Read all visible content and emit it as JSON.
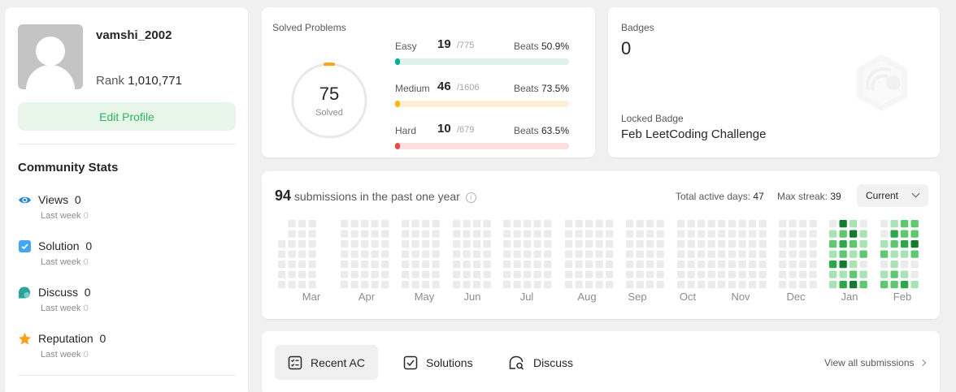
{
  "profile": {
    "username": "vamshi_2002",
    "rank_label": "Rank",
    "rank_value": "1,010,771",
    "edit_button": "Edit Profile"
  },
  "community": {
    "title": "Community Stats",
    "stats": [
      {
        "label": "Views",
        "value": "0",
        "sub_label": "Last week",
        "sub_value": "0",
        "icon": "eye-icon",
        "color": "#1e88e5"
      },
      {
        "label": "Solution",
        "value": "0",
        "sub_label": "Last week",
        "sub_value": "0",
        "icon": "solution-check-icon",
        "color": "#42a5f5"
      },
      {
        "label": "Discuss",
        "value": "0",
        "sub_label": "Last week",
        "sub_value": "0",
        "icon": "discuss-bubble-icon",
        "color": "#26a69a"
      },
      {
        "label": "Reputation",
        "value": "0",
        "sub_label": "Last week",
        "sub_value": "0",
        "icon": "star-icon",
        "color": "#ffa116"
      }
    ]
  },
  "solved": {
    "label": "Solved Problems",
    "total": "75",
    "total_label": "Solved",
    "difficulties": [
      {
        "name": "Easy",
        "count": "19",
        "total": "/775",
        "beats_label": "Beats",
        "beats": "50.9%",
        "fraction": 0.0245,
        "color": "#00af9b",
        "track": "#dcf1e8"
      },
      {
        "name": "Medium",
        "count": "46",
        "total": "/1606",
        "beats_label": "Beats",
        "beats": "73.5%",
        "fraction": 0.0286,
        "color": "#ffb800",
        "track": "#fdf0d6"
      },
      {
        "name": "Hard",
        "count": "10",
        "total": "/679",
        "beats_label": "Beats",
        "beats": "63.5%",
        "fraction": 0.0147,
        "color": "#ef4743",
        "track": "#fbe0df"
      }
    ]
  },
  "badges": {
    "label": "Badges",
    "count": "0",
    "locked_label": "Locked Badge",
    "locked_name": "Feb LeetCoding Challenge"
  },
  "submissions": {
    "count": "94",
    "text": "submissions in the past one year",
    "active_days_label": "Total active days:",
    "active_days": "47",
    "max_streak_label": "Max streak:",
    "max_streak": "39",
    "select_value": "Current",
    "months": [
      "Mar",
      "Apr",
      "May",
      "Jun",
      "Jul",
      "Aug",
      "Sep",
      "Oct",
      "Nov",
      "Dec",
      "Jan",
      "Feb"
    ],
    "colors": {
      "empty": "#ebebeb",
      "l1": "#a8e3b4",
      "l2": "#5cc96f",
      "l3": "#2aa84a",
      "l4": "#137b2e"
    }
  },
  "tabs": {
    "items": [
      {
        "label": "Recent AC",
        "active": true
      },
      {
        "label": "Solutions",
        "active": false
      },
      {
        "label": "Discuss",
        "active": false
      }
    ],
    "view_all": "View all submissions"
  }
}
